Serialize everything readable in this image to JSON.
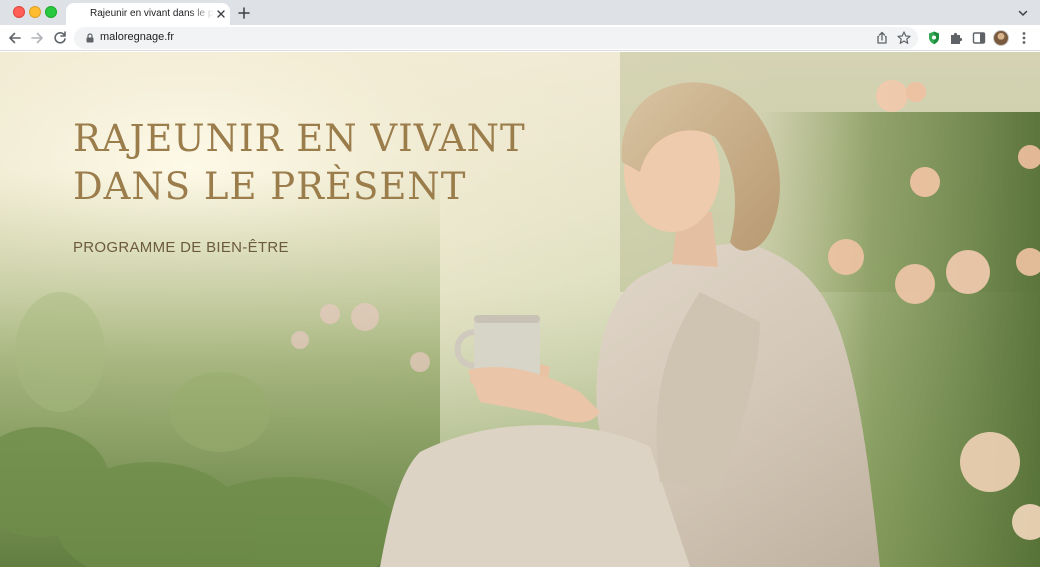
{
  "browser": {
    "tab": {
      "title": "Rajeunir en vivant dans le présent"
    },
    "address_bar": {
      "url": "maloregnage.fr"
    },
    "icons": {
      "back": "arrow-left-icon",
      "forward": "arrow-right-icon",
      "reload": "reload-icon",
      "lock": "lock-icon",
      "share": "share-icon",
      "bookmark": "star-icon",
      "extension_1": "shield-extension-icon",
      "extension_2": "puzzle-icon",
      "side_panel": "side-panel-icon",
      "menu": "kebab-icon",
      "new_tab": "plus-icon",
      "close_tab": "close-icon",
      "tab_search": "chevron-down-icon"
    }
  },
  "page": {
    "hero": {
      "title_line_1": "RAJEUNIR EN VIVANT",
      "title_line_2": "DANS LE PRÈSENT",
      "subtitle": "PROGRAMME DE BIEN-ÊTRE"
    }
  },
  "colors": {
    "title": "#9b7d4c",
    "subtitle": "#6c5a3d",
    "chrome_bg": "#dee1e6",
    "omnibox_bg": "#f1f3f4"
  }
}
